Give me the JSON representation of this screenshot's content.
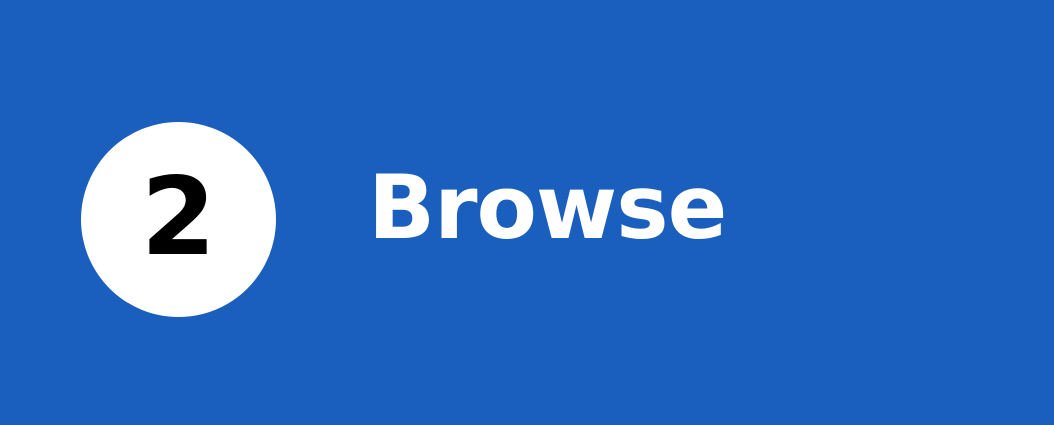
{
  "step": {
    "number": "2",
    "label": "Browse"
  },
  "colors": {
    "background": "#1a5fbd",
    "circle": "#ffffff",
    "number_text": "#000000",
    "label_text": "#ffffff"
  }
}
